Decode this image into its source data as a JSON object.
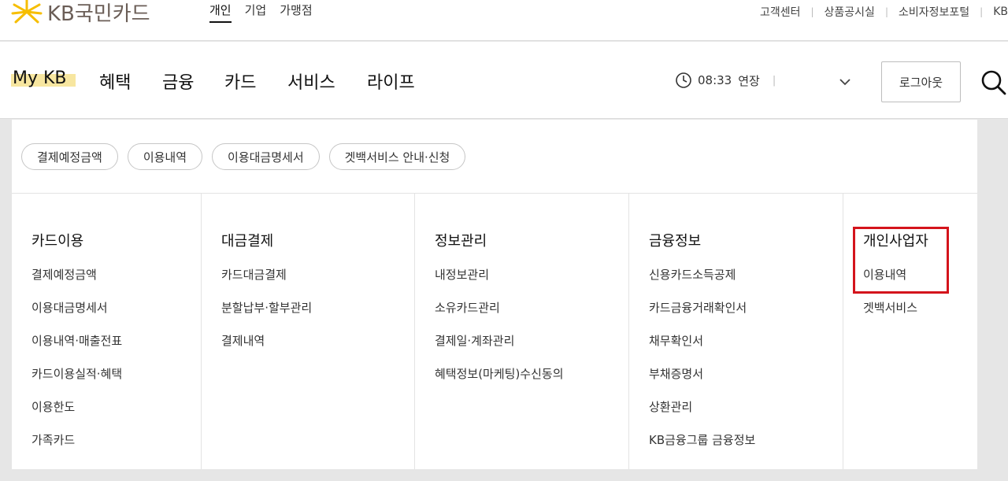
{
  "brand": {
    "name": "KB국민카드",
    "star_color": "#f6be00",
    "text_color": "#6b5e57"
  },
  "top": {
    "segments": [
      {
        "label": "개인",
        "active": true
      },
      {
        "label": "기업",
        "active": false
      },
      {
        "label": "가맹점",
        "active": false
      }
    ],
    "util_links": [
      "고객센터",
      "상품공시실",
      "소비자정보포털",
      "KB"
    ]
  },
  "gnb": {
    "items": [
      "My KB",
      "혜택",
      "금융",
      "카드",
      "서비스",
      "라이프"
    ],
    "session_time": "08:33",
    "extend_label": "연장",
    "logout_label": "로그아웃"
  },
  "panel": {
    "quick_chips": [
      "결제예정금액",
      "이용내역",
      "이용대금명세서",
      "겟백서비스 안내·신청"
    ],
    "columns": [
      {
        "title": "카드이용",
        "items": [
          "결제예정금액",
          "이용대금명세서",
          "이용내역·매출전표",
          "카드이용실적·혜택",
          "이용한도",
          "가족카드"
        ]
      },
      {
        "title": "대금결제",
        "items": [
          "카드대금결제",
          "분할납부·할부관리",
          "결제내역"
        ]
      },
      {
        "title": "정보관리",
        "items": [
          "내정보관리",
          "소유카드관리",
          "결제일·계좌관리",
          "혜택정보(마케팅)수신동의"
        ]
      },
      {
        "title": "금융정보",
        "items": [
          "신용카드소득공제",
          "카드금융거래확인서",
          "채무확인서",
          "부채증명서",
          "상환관리",
          "KB금융그룹 금융정보"
        ]
      },
      {
        "title": "개인사업자",
        "items": [
          "이용내역",
          "겟백서비스"
        ]
      }
    ]
  },
  "colors": {
    "highlight_box": "#d4141c",
    "mykb_highlight": "#f7e6a0"
  }
}
